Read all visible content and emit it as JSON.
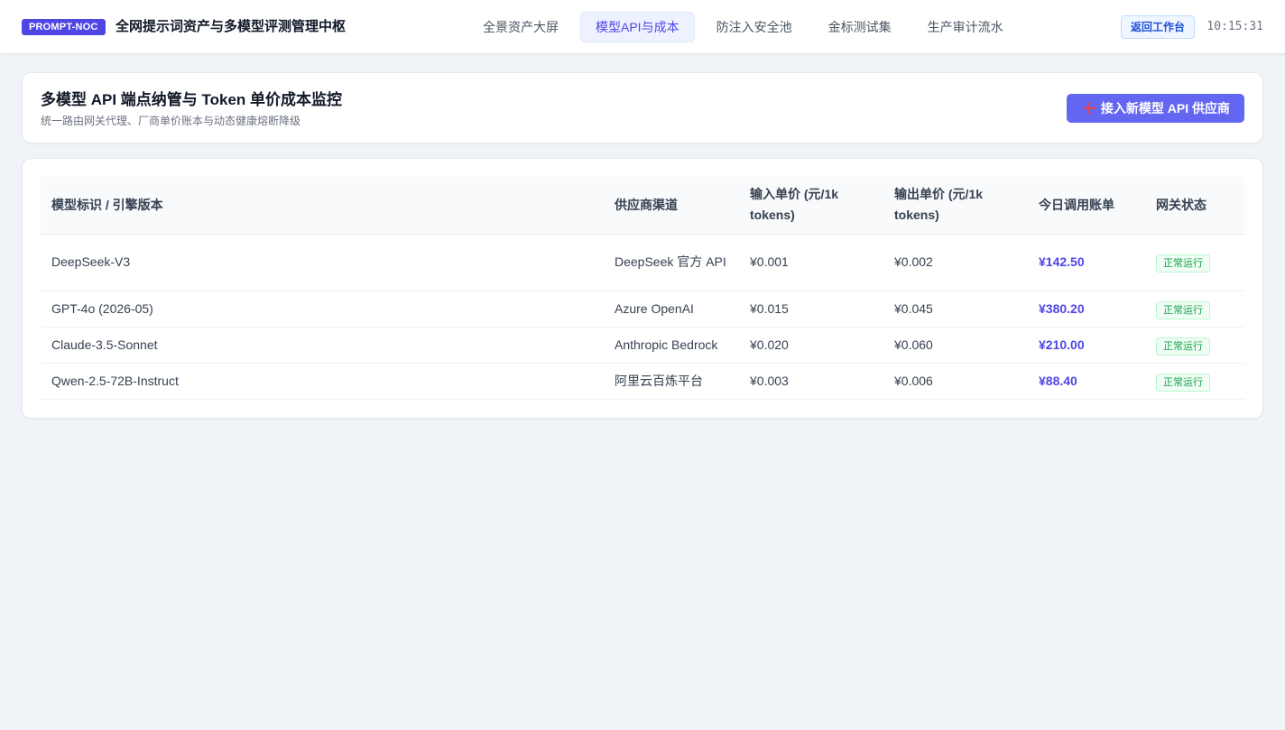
{
  "topbar": {
    "brand_badge": "PROMPT-NOC",
    "app_title": "全网提示词资产与多模型评测管理中枢",
    "tabs": [
      {
        "label": "全景资产大屏"
      },
      {
        "label": "模型API与成本",
        "active": true
      },
      {
        "label": "防注入安全池"
      },
      {
        "label": "金标测试集"
      },
      {
        "label": "生产审计流水"
      }
    ],
    "back_label": "返回工作台",
    "clock": "10:15:31"
  },
  "header": {
    "title": "多模型 API 端点纳管与 Token 单价成本监控",
    "subtitle": "统一路由网关代理、厂商单价账本与动态健康熔断降级",
    "add_button": "接入新模型 API 供应商"
  },
  "table": {
    "columns": [
      "模型标识 / 引擎版本",
      "供应商渠道",
      "输入单价 (元/1k tokens)",
      "输出单价 (元/1k tokens)",
      "今日调用账单",
      "网关状态"
    ],
    "rows": [
      {
        "model": "DeepSeek-V3",
        "provider": "DeepSeek 官方 API",
        "input_price": "¥0.001",
        "output_price": "¥0.002",
        "bill": "¥142.50",
        "status": "正常运行"
      },
      {
        "model": "GPT-4o (2026-05)",
        "provider": "Azure OpenAI",
        "input_price": "¥0.015",
        "output_price": "¥0.045",
        "bill": "¥380.20",
        "status": "正常运行"
      },
      {
        "model": "Claude-3.5-Sonnet",
        "provider": "Anthropic Bedrock",
        "input_price": "¥0.020",
        "output_price": "¥0.060",
        "bill": "¥210.00",
        "status": "正常运行"
      },
      {
        "model": "Qwen-2.5-72B-Instruct",
        "provider": "阿里云百炼平台",
        "input_price": "¥0.003",
        "output_price": "¥0.006",
        "bill": "¥88.40",
        "status": "正常运行"
      }
    ]
  },
  "colors": {
    "accent": "#4f46e5",
    "button": "#6366f1",
    "status_ok": "#16a34a",
    "background": "#f0f3f7"
  }
}
